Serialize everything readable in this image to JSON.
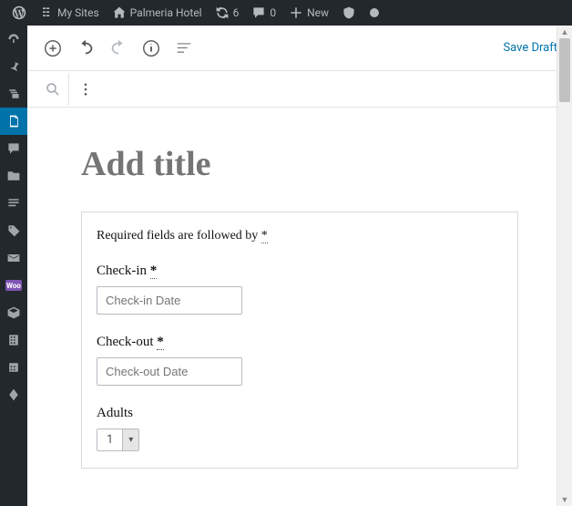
{
  "adminbar": {
    "mysites_label": "My Sites",
    "site_name": "Palmeria Hotel",
    "updates_count": "6",
    "comments_count": "0",
    "new_label": "New"
  },
  "toolbar": {
    "save_draft_label": "Save Draft"
  },
  "title_placeholder": "Add title",
  "form": {
    "required_note_pre": "Required fields are followed by ",
    "asterisk": "*",
    "checkin_label": "Check-in ",
    "checkin_placeholder": "Check-in Date",
    "checkout_label": "Check-out ",
    "checkout_placeholder": "Check-out Date",
    "adults_label": "Adults",
    "adults_value": "1"
  },
  "leftrail_items": [
    {
      "name": "dashboard-icon"
    },
    {
      "name": "pin-icon"
    },
    {
      "name": "store-icon"
    },
    {
      "name": "pages-icon"
    },
    {
      "name": "comments-icon"
    },
    {
      "name": "folder-icon"
    },
    {
      "name": "forms-icon"
    },
    {
      "name": "tickets-icon"
    },
    {
      "name": "mail-icon"
    },
    {
      "name": "woocommerce-icon"
    },
    {
      "name": "products-icon"
    },
    {
      "name": "building-icon"
    },
    {
      "name": "calendar-icon"
    },
    {
      "name": "more-icon"
    }
  ]
}
